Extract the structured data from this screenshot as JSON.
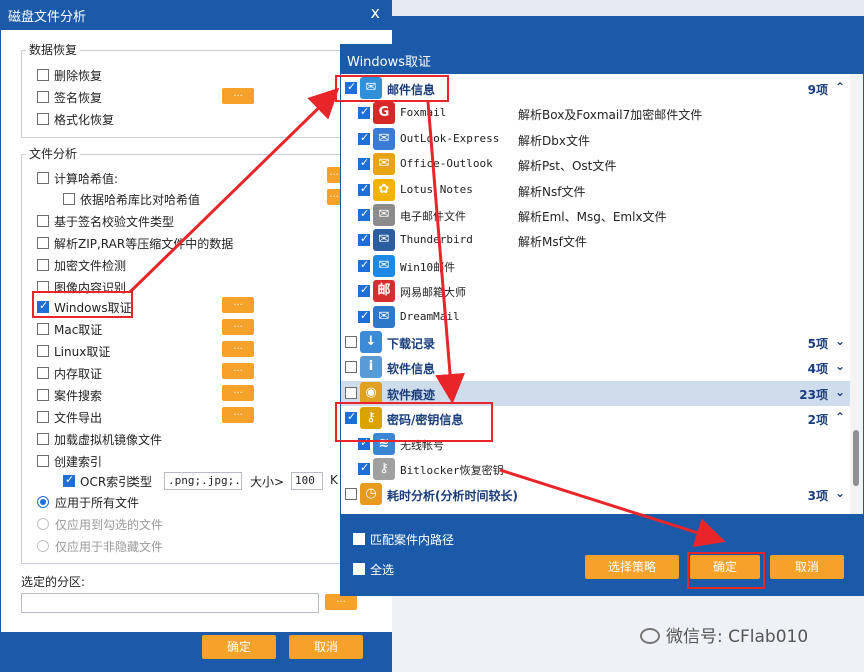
{
  "back_window": {
    "title": "磁盘文件分析",
    "close": "x",
    "recovery_group": {
      "label": "数据恢复",
      "items": [
        {
          "label": "删除恢复",
          "checked": false
        },
        {
          "label": "签名恢复",
          "checked": false
        },
        {
          "label": "格式化恢复",
          "checked": false
        }
      ]
    },
    "analysis_group": {
      "label": "文件分析",
      "items": [
        {
          "label": "计算哈希值:",
          "checked": false
        },
        {
          "label": "依据哈希库比对哈希值",
          "checked": false
        },
        {
          "label": "基于签名校验文件类型",
          "checked": false
        },
        {
          "label": "解析ZIP,RAR等压缩文件中的数据",
          "checked": false
        },
        {
          "label": "加密文件检测",
          "checked": false
        },
        {
          "label": "图像内容识别",
          "checked": false
        },
        {
          "label": "Windows取证",
          "checked": true
        },
        {
          "label": "Mac取证",
          "checked": false
        },
        {
          "label": "Linux取证",
          "checked": false
        },
        {
          "label": "内存取证",
          "checked": false
        },
        {
          "label": "案件搜索",
          "checked": false
        },
        {
          "label": "文件导出",
          "checked": false
        },
        {
          "label": "加载虚拟机镜像文件",
          "checked": false
        },
        {
          "label": "创建索引",
          "checked": false
        },
        {
          "label": "OCR索引",
          "checked": true
        }
      ],
      "ocr": {
        "type_label": "类型",
        "type_value": ".png;.jpg;.P",
        "size_label": "大小>",
        "size_value": "100",
        "unit_label": "K"
      },
      "radios": [
        {
          "label": "应用于所有文件",
          "selected": true,
          "enabled": true
        },
        {
          "label": "仅应用到勾选的文件",
          "selected": false,
          "enabled": false
        },
        {
          "label": "仅应用于非隐藏文件",
          "selected": false,
          "enabled": false
        }
      ]
    },
    "partition_label": "选定的分区:",
    "partition_value": "",
    "dots": "...",
    "ok": "确定",
    "cancel": "取消"
  },
  "front_window": {
    "title": "Windows取证",
    "rows": [
      {
        "kind": "cat",
        "label": "邮件信息",
        "count": "9项",
        "chevron": "^",
        "checked": true,
        "icon": "mail-info-icon"
      },
      {
        "kind": "item",
        "label": "Foxmail",
        "desc": "解析Box及Foxmail7加密邮件文件",
        "checked": true,
        "icon": "foxmail-icon"
      },
      {
        "kind": "item",
        "label": "OutLook-Express",
        "desc": "解析Dbx文件",
        "checked": true,
        "icon": "outlook-express-icon"
      },
      {
        "kind": "item",
        "label": "Office-Outlook",
        "desc": "解析Pst、Ost文件",
        "checked": true,
        "icon": "office-outlook-icon"
      },
      {
        "kind": "item",
        "label": "Lotus Notes",
        "desc": "解析Nsf文件",
        "checked": true,
        "icon": "lotus-notes-icon"
      },
      {
        "kind": "item",
        "label": "电子邮件文件",
        "desc": "解析Eml、Msg、Emlx文件",
        "checked": true,
        "icon": "envelope-icon"
      },
      {
        "kind": "item",
        "label": "Thunderbird",
        "desc": "解析Msf文件",
        "checked": true,
        "icon": "thunderbird-icon"
      },
      {
        "kind": "item",
        "label": "Win10邮件",
        "desc": "",
        "checked": true,
        "icon": "win10-mail-icon"
      },
      {
        "kind": "item",
        "label": "网易邮箱大师",
        "desc": "",
        "checked": true,
        "icon": "netease-mail-icon"
      },
      {
        "kind": "item",
        "label": "DreamMail",
        "desc": "",
        "checked": true,
        "icon": "dreammail-icon"
      },
      {
        "kind": "cat",
        "label": "下载记录",
        "count": "5项",
        "chevron": "v",
        "checked": false,
        "icon": "download-icon"
      },
      {
        "kind": "cat",
        "label": "软件信息",
        "count": "4项",
        "chevron": "v",
        "checked": false,
        "icon": "software-info-icon"
      },
      {
        "kind": "cat",
        "label": "软件痕迹",
        "count": "23项",
        "chevron": "v",
        "checked": false,
        "icon": "software-trace-icon",
        "highlight": true
      },
      {
        "kind": "cat",
        "label": "密码/密钥信息",
        "count": "2项",
        "chevron": "^",
        "checked": true,
        "icon": "key-icon"
      },
      {
        "kind": "item",
        "label": "无线帐号",
        "desc": "",
        "checked": true,
        "icon": "wifi-icon"
      },
      {
        "kind": "item",
        "label": "Bitlocker恢复密钥",
        "desc": "",
        "checked": true,
        "icon": "bitlocker-key-icon"
      },
      {
        "kind": "cat",
        "label": "耗时分析(分析时间较长)",
        "count": "3项",
        "chevron": "v",
        "checked": false,
        "icon": "clock-icon"
      }
    ],
    "match_path_label": "匹配案件内路径",
    "select_all_label": "全选",
    "strategy": "选择策略",
    "ok": "确定",
    "cancel": "取消"
  },
  "watermark": "微信号: CFlab010",
  "colors": {
    "title_blue": "#1a5aa8",
    "accent_orange": "#f6a12a",
    "annotation_red": "#e8262a"
  }
}
